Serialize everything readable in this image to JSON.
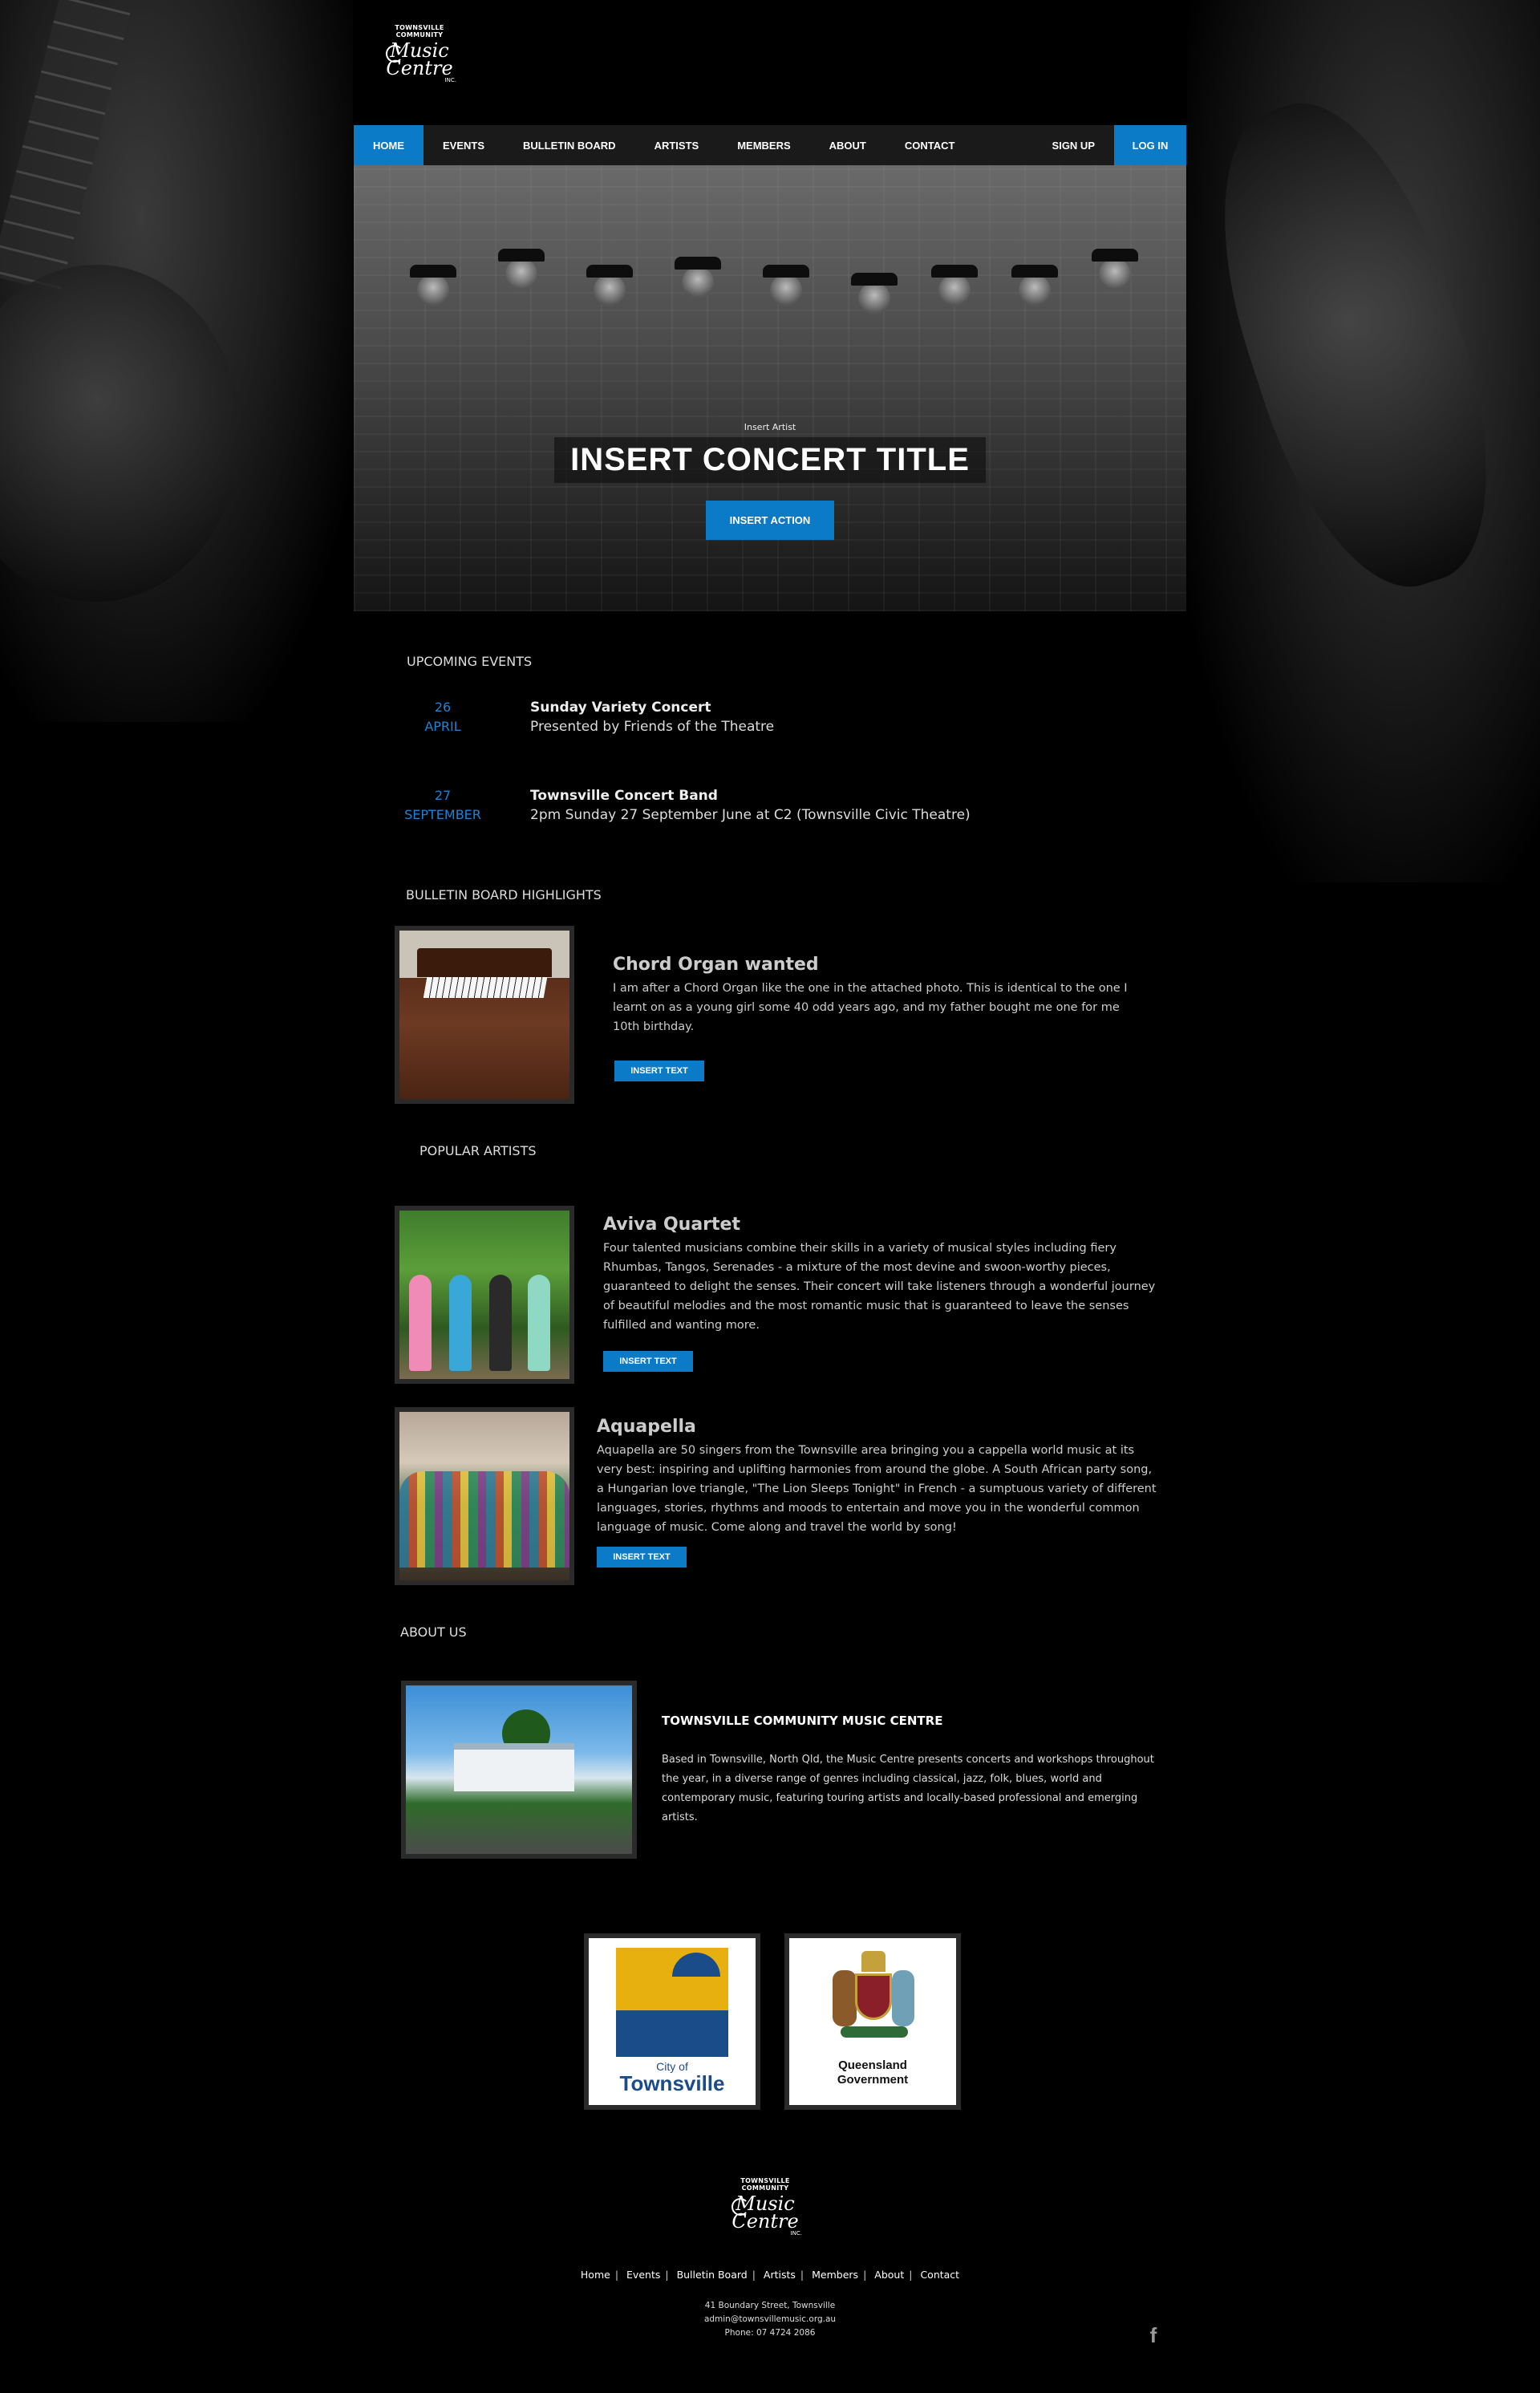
{
  "logo": {
    "line1": "TOWNSVILLE COMMUNITY",
    "line2": "Music",
    "line3": "Centre",
    "line4": "INC."
  },
  "nav": {
    "items": [
      "HOME",
      "EVENTS",
      "BULLETIN BOARD",
      "ARTISTS",
      "MEMBERS",
      "ABOUT",
      "CONTACT"
    ],
    "signup": "SIGN UP",
    "login": "LOG IN"
  },
  "hero": {
    "artist": "Insert Artist",
    "title": "INSERT CONCERT TITLE",
    "action": "INSERT ACTION"
  },
  "events": {
    "heading": "UPCOMING EVENTS",
    "items": [
      {
        "day": "26",
        "month": "APRIL",
        "name": "Sunday Variety Concert",
        "desc": "Presented by Friends of the Theatre"
      },
      {
        "day": "27",
        "month": "SEPTEMBER",
        "name": "Townsville Concert Band",
        "desc": "2pm Sunday 27 September June at C2 (Townsville Civic Theatre)"
      }
    ]
  },
  "bulletin": {
    "heading": "BULLETIN BOARD HIGHLIGHTS",
    "title": "Chord Organ wanted",
    "text": "I am after a Chord Organ like the one in the attached photo. This is identical to the one I learnt on as a young girl some 40 odd years ago, and my father bought me one for me 10th birthday.",
    "button": "INSERT TEXT"
  },
  "artists": {
    "heading": "POPULAR ARTISTS",
    "items": [
      {
        "name": "Aviva Quartet",
        "text": "Four talented musicians combine their skills in a variety of musical styles including fiery Rhumbas, Tangos, Serenades - a mixture of the most devine and swoon-worthy pieces, guaranteed to delight the senses. Their concert will take listeners through a wonderful journey of beautiful melodies and the most romantic music that is guaranteed to leave the senses fulfilled and wanting more.",
        "button": "INSERT TEXT"
      },
      {
        "name": "Aquapella",
        "text": "Aquapella are 50 singers from the Townsville area bringing you a cappella world music at its very best: inspiring and uplifting harmonies from around the globe. A South African party song, a Hungarian love triangle, \"The Lion Sleeps Tonight\" in French - a sumptuous variety of different languages, stories, rhythms and moods to entertain and move you in the wonderful common language of music. Come along and travel the world by song!",
        "button": "INSERT TEXT"
      }
    ]
  },
  "about": {
    "heading": "ABOUT US",
    "title": "TOWNSVILLE COMMUNITY MUSIC CENTRE",
    "text": "Based in Townsville, North Qld, the Music Centre presents concerts and workshops throughout the year, in a diverse range of genres including classical, jazz, folk, blues, world and contemporary music, featuring touring artists and locally-based professional and emerging artists."
  },
  "sponsors": {
    "townsville": {
      "city": "City of",
      "town": "Townsville"
    },
    "qld": {
      "line1": "Queensland",
      "line2": "Government"
    }
  },
  "footer": {
    "links": [
      "Home",
      "Events",
      "Bulletin Board",
      "Artists",
      "Members",
      "About",
      "Contact"
    ],
    "address": "41 Boundary Street, Townsville",
    "email": "admin@townsvillemusic.org.au",
    "phone": "Phone: 07 4724 2086",
    "social_icon": "facebook-icon"
  },
  "colors": {
    "accent": "#0b7ac7",
    "date": "#1e82d2",
    "background": "#000000"
  }
}
